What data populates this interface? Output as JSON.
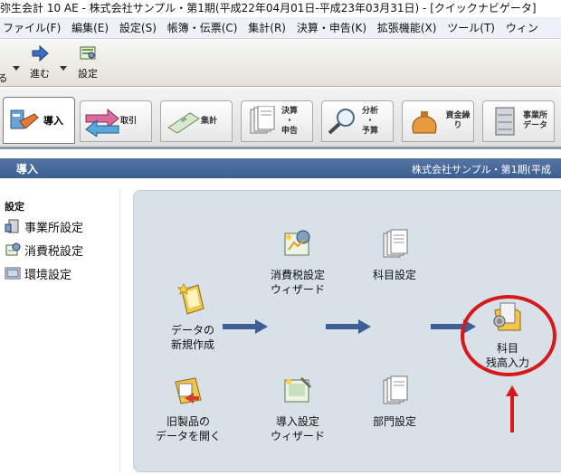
{
  "window": {
    "title": "弥生会計 10 AE - 株式会社サンプル・第1期(平成22年04月01日-平成23年03月31日) - [クイックナビゲータ]"
  },
  "menu": [
    {
      "label": "ファイル(F)"
    },
    {
      "label": "編集(E)"
    },
    {
      "label": "設定(S)"
    },
    {
      "label": "帳簿・伝票(C)"
    },
    {
      "label": "集計(R)"
    },
    {
      "label": "決算・申告(K)"
    },
    {
      "label": "拡張機能(X)"
    },
    {
      "label": "ツール(T)"
    },
    {
      "label": "ウィン"
    }
  ],
  "toolbar": {
    "back_label": "る",
    "forward_label": "進む",
    "settings_label": "設定"
  },
  "tabs": [
    {
      "label": "導入"
    },
    {
      "label": "取引"
    },
    {
      "label": "集計"
    },
    {
      "label": "決算\n・\n申告"
    },
    {
      "label": "分析\n・\n予算"
    },
    {
      "label": "資金繰り"
    },
    {
      "label": "事業所\nデータ"
    }
  ],
  "section": {
    "title": "導入",
    "company": "株式会社サンプル・第1期(平成"
  },
  "sidebar": {
    "heading": "設定",
    "items": [
      {
        "label": "事業所設定"
      },
      {
        "label": "消費税設定"
      },
      {
        "label": "環境設定"
      }
    ]
  },
  "flow": {
    "new_data": "データの\n新規作成",
    "tax_wizard": "消費税設定\nウィザード",
    "account_settings": "科目設定",
    "opening_balance": "科目\n残高入力",
    "open_old": "旧製品の\nデータを開く",
    "setup_wizard": "導入設定\nウィザード",
    "dept_settings": "部門設定"
  },
  "colors": {
    "section_bar": "#4a6b9c",
    "panel_bg": "#d8e0e8",
    "arrow_blue": "#3f5f94",
    "highlight_red": "#d7191c"
  }
}
